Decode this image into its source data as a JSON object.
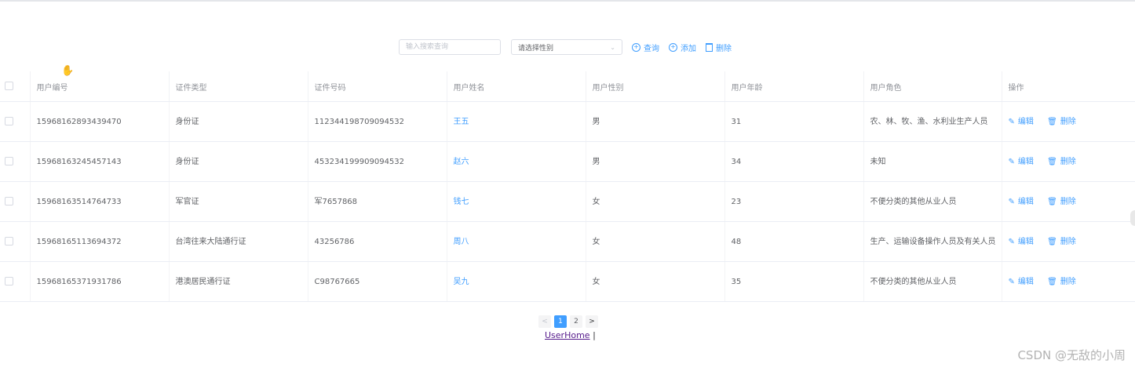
{
  "toolbar": {
    "search_placeholder": "输入搜索查询",
    "gender_select_value": "请选择性别",
    "query_label": "查询",
    "add_label": "添加",
    "delete_label": "删除"
  },
  "table": {
    "headers": [
      "用户编号",
      "证件类型",
      "证件号码",
      "用户姓名",
      "用户性别",
      "用户年龄",
      "用户角色",
      "操作"
    ],
    "rows": [
      {
        "id": "15968162893439470",
        "id_type": "身份证",
        "id_number": "112344198709094532",
        "name": "王五",
        "gender": "男",
        "age": "31",
        "role": "农、林、牧、渔、水利业生产人员"
      },
      {
        "id": "15968163245457143",
        "id_type": "身份证",
        "id_number": "453234199909094532",
        "name": "赵六",
        "gender": "男",
        "age": "34",
        "role": "未知"
      },
      {
        "id": "15968163514764733",
        "id_type": "军官证",
        "id_number": "军7657868",
        "name": "钱七",
        "gender": "女",
        "age": "23",
        "role": "不便分类的其他从业人员"
      },
      {
        "id": "15968165113694372",
        "id_type": "台湾往来大陆通行证",
        "id_number": "43256786",
        "name": "周八",
        "gender": "女",
        "age": "48",
        "role": "生产、运输设备操作人员及有关人员"
      },
      {
        "id": "15968165371931786",
        "id_type": "港澳居民通行证",
        "id_number": "C98767665",
        "name": "吴九",
        "gender": "女",
        "age": "35",
        "role": "不便分类的其他从业人员"
      }
    ],
    "row_actions": {
      "edit": "编辑",
      "delete": "删除"
    }
  },
  "pagination": {
    "prev": "<",
    "pages": [
      "1",
      "2"
    ],
    "current": "1",
    "next": ">"
  },
  "footer_link": {
    "text": "UserHome",
    "separator": "|"
  },
  "watermark": "CSDN @无敌的小周",
  "colors": {
    "accent": "#409eff",
    "header_text": "#909399",
    "body_text": "#606266",
    "border": "#ebeef5"
  },
  "icons": {
    "search": "plus-circle-icon",
    "add": "plus-circle-icon",
    "delete": "trash-icon",
    "edit": "pencil-icon",
    "cursor": "hand-cursor-icon"
  }
}
